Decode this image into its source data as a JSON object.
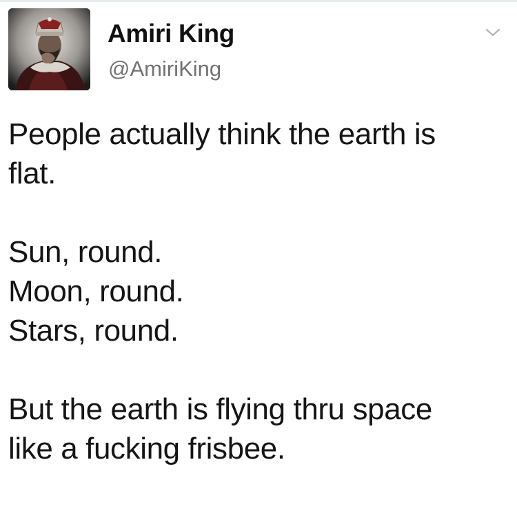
{
  "tweet": {
    "author": {
      "display_name": "Amiri King",
      "handle": "@AmiriKing"
    },
    "icons": {
      "avatar": "profile-photo",
      "menu": "chevron-down-icon"
    },
    "colors": {
      "name": "#111111",
      "handle": "#727272",
      "text": "#151515",
      "chevron": "#b5b5b5"
    },
    "body": {
      "line1": "People actually think the earth is",
      "line2": "flat.",
      "line3": "Sun, round.",
      "line4": "Moon, round.",
      "line5": "Stars, round.",
      "line6": "But the earth is flying thru space",
      "line7": "like a fucking frisbee."
    }
  }
}
